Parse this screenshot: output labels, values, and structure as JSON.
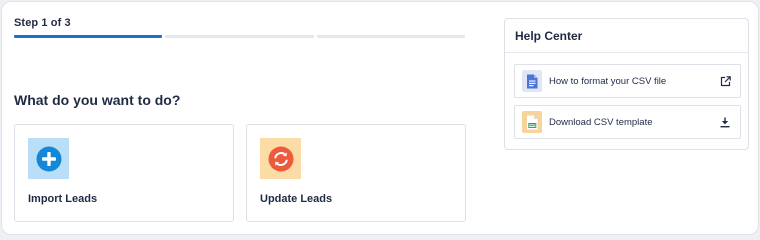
{
  "wizard": {
    "step_label": "Step 1 of 3",
    "steps_total": 3,
    "current_step": 1,
    "accent_color": "#1a6fd1"
  },
  "main": {
    "question": "What do you want to do?",
    "options": [
      {
        "label": "Import Leads",
        "icon": "plus-circle-icon",
        "color": "#1488d8"
      },
      {
        "label": "Update Leads",
        "icon": "refresh-circle-icon",
        "color": "#ee5a3c"
      }
    ]
  },
  "help_center": {
    "title": "Help Center",
    "links": [
      {
        "label": "How to format your CSV file",
        "icon": "document-icon",
        "action_icon": "external-link-icon"
      },
      {
        "label": "Download CSV template",
        "icon": "csv-file-icon",
        "action_icon": "download-icon"
      }
    ]
  }
}
